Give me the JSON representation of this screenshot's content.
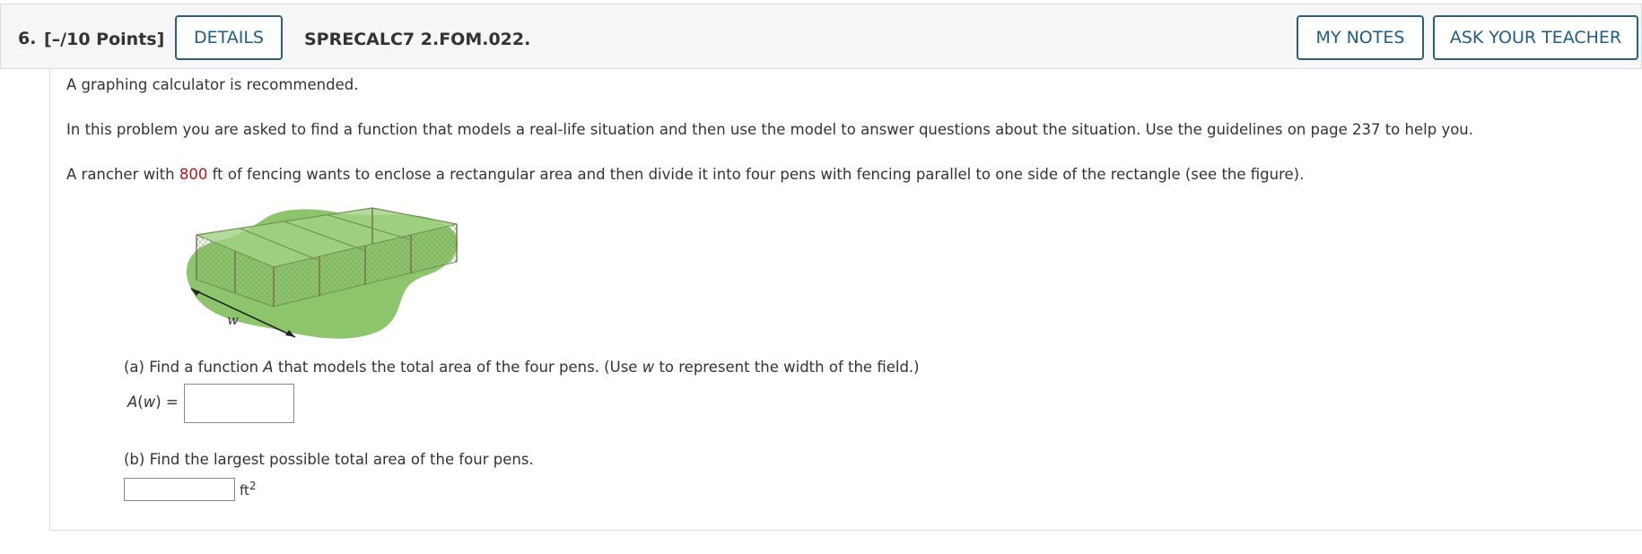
{
  "header": {
    "number": "6.",
    "points": "[–/10 Points]",
    "details_label": "DETAILS",
    "code": "SPRECALC7 2.FOM.022.",
    "my_notes_label": "MY NOTES",
    "ask_teacher_label": "ASK YOUR TEACHER",
    "button_color": "#1f5c86"
  },
  "problem": {
    "calc_note": "A graphing calculator is recommended.",
    "intro": "In this problem you are asked to find a function that models a real-life situation and then use the model to answer questions about the situation. Use the guidelines on page 237 to help you.",
    "statement_before": "A rancher with",
    "fencing_value": "800",
    "statement_after": "ft of fencing wants to enclose a rectangular area and then divide it into four pens with fencing parallel to one side of the rectangle (see the figure).",
    "highlight_color": "#b5191a"
  },
  "figure": {
    "width_label": "w"
  },
  "part_a": {
    "q_before": "(a) Find a function",
    "q_var": "A",
    "q_mid": "that models the total area of the four pens. (Use",
    "q_var2": "w",
    "q_after": "to represent the width of the field.)",
    "lhs_fn": "A",
    "lhs_paren_open": "(",
    "lhs_arg": "w",
    "lhs_paren_close": ") =",
    "answer_value": ""
  },
  "part_b": {
    "question": "(b) Find the largest possible total area of the four pens.",
    "answer_value": "",
    "unit": "ft",
    "unit_exp": "2"
  }
}
